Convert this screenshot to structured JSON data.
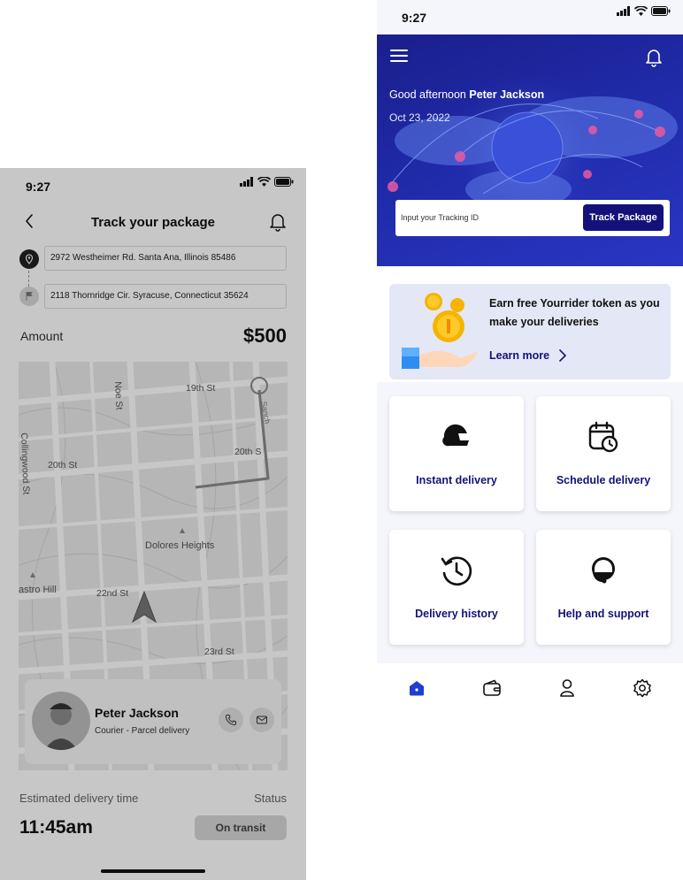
{
  "track_screen": {
    "status_time": "9:27",
    "title": "Track your package",
    "pickup_address": "2972 Westheimer Rd. Santa Ana, Illinois 85486",
    "dropoff_address": "2118 Thornridge Cir. Syracuse, Connecticut 35624",
    "amount_label": "Amount",
    "amount_value": "$500",
    "map_labels": {
      "street_noe": "Noe St",
      "street_19th": "19th St",
      "street_20th_left": "20th St",
      "street_20th_right": "20th S",
      "street_collingwood": "Collingwood St",
      "area_dolores": "Dolores Heights",
      "area_castro": "astro Hill",
      "street_22nd": "22nd St",
      "street_23rd": "23rd St",
      "street_sanch": "Sanch"
    },
    "courier": {
      "name": "Peter Jackson",
      "role": "Courier - Parcel delivery"
    },
    "eta_label": "Estimated delivery time",
    "status_label": "Status",
    "eta_value": "11:45am",
    "status_value": "On transit"
  },
  "home_screen": {
    "status_time": "9:27",
    "greeting": "Good afternoon",
    "user_name": "Peter Jackson",
    "date": "Oct 23, 2022",
    "tracking_placeholder": "Input your Tracking ID",
    "track_button": "Track Package",
    "promo": {
      "text": "Earn free Yourrider token as you make your deliveries",
      "link": "Learn more"
    },
    "services": [
      {
        "label": "Instant delivery",
        "icon": "helmet-icon"
      },
      {
        "label": "Schedule delivery",
        "icon": "calendar-clock-icon"
      },
      {
        "label": "Delivery history",
        "icon": "history-icon"
      },
      {
        "label": "Help and support",
        "icon": "support-icon"
      }
    ],
    "tabs": [
      "home-icon",
      "wallet-icon",
      "profile-icon",
      "settings-icon"
    ]
  },
  "colors": {
    "brand": "#14127a",
    "hero_bg": "#1f2aa8",
    "active_tab": "#1f3fd1",
    "promo_bg": "#e4e7f6"
  }
}
